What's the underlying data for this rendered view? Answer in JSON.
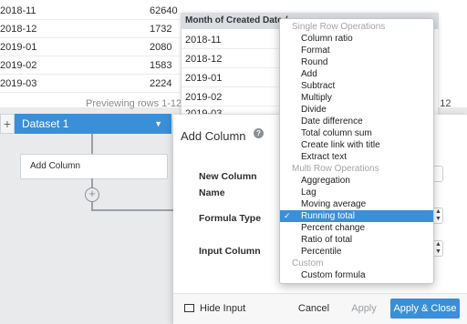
{
  "background_table": {
    "rows": [
      {
        "month": "2018-11",
        "value": "62640"
      },
      {
        "month": "2018-12",
        "value": "1732"
      },
      {
        "month": "2019-01",
        "value": "2080"
      },
      {
        "month": "2019-02",
        "value": "1583"
      },
      {
        "month": "2019-03",
        "value": "2224"
      }
    ],
    "preview_text": "Previewing rows 1-12 of",
    "preview_right": "of 12"
  },
  "overlay_table": {
    "header": "Month of Created Date (",
    "rows": [
      "2018-11",
      "2018-12",
      "2019-01",
      "2019-02",
      "2019-03"
    ]
  },
  "dataset": {
    "plus": "+",
    "label": "Dataset 1",
    "caret": "▼"
  },
  "flow": {
    "node_label": "Add Column",
    "plus": "+"
  },
  "dialog": {
    "title": "Add Column",
    "help": "?",
    "new_column_label": "New Column",
    "name_label": "Name",
    "formula_type_label": "Formula Type",
    "input_column_label": "Input Column",
    "footer": {
      "hide_input": "Hide Input",
      "cancel": "Cancel",
      "apply": "Apply",
      "apply_close": "Apply & Close"
    }
  },
  "menu": {
    "items": [
      {
        "label": "Single Row Operations",
        "header": true
      },
      {
        "label": "Column ratio"
      },
      {
        "label": "Format"
      },
      {
        "label": "Round"
      },
      {
        "label": "Add"
      },
      {
        "label": "Subtract"
      },
      {
        "label": "Multiply"
      },
      {
        "label": "Divide"
      },
      {
        "label": "Date difference"
      },
      {
        "label": "Total column sum"
      },
      {
        "label": "Create link with title"
      },
      {
        "label": "Extract text"
      },
      {
        "label": "Multi Row Operations",
        "header": true
      },
      {
        "label": "Aggregation"
      },
      {
        "label": "Lag"
      },
      {
        "label": "Moving average"
      },
      {
        "label": "Running total",
        "selected": true
      },
      {
        "label": "Percent change"
      },
      {
        "label": "Ratio of total"
      },
      {
        "label": "Percentile"
      },
      {
        "label": "Custom",
        "header": true
      },
      {
        "label": "Custom formula"
      }
    ],
    "check_mark": "✓"
  },
  "colors": {
    "accent": "#3a8fd8",
    "menu_header": "#a4a4a4",
    "canvas": "#e9eaec"
  }
}
